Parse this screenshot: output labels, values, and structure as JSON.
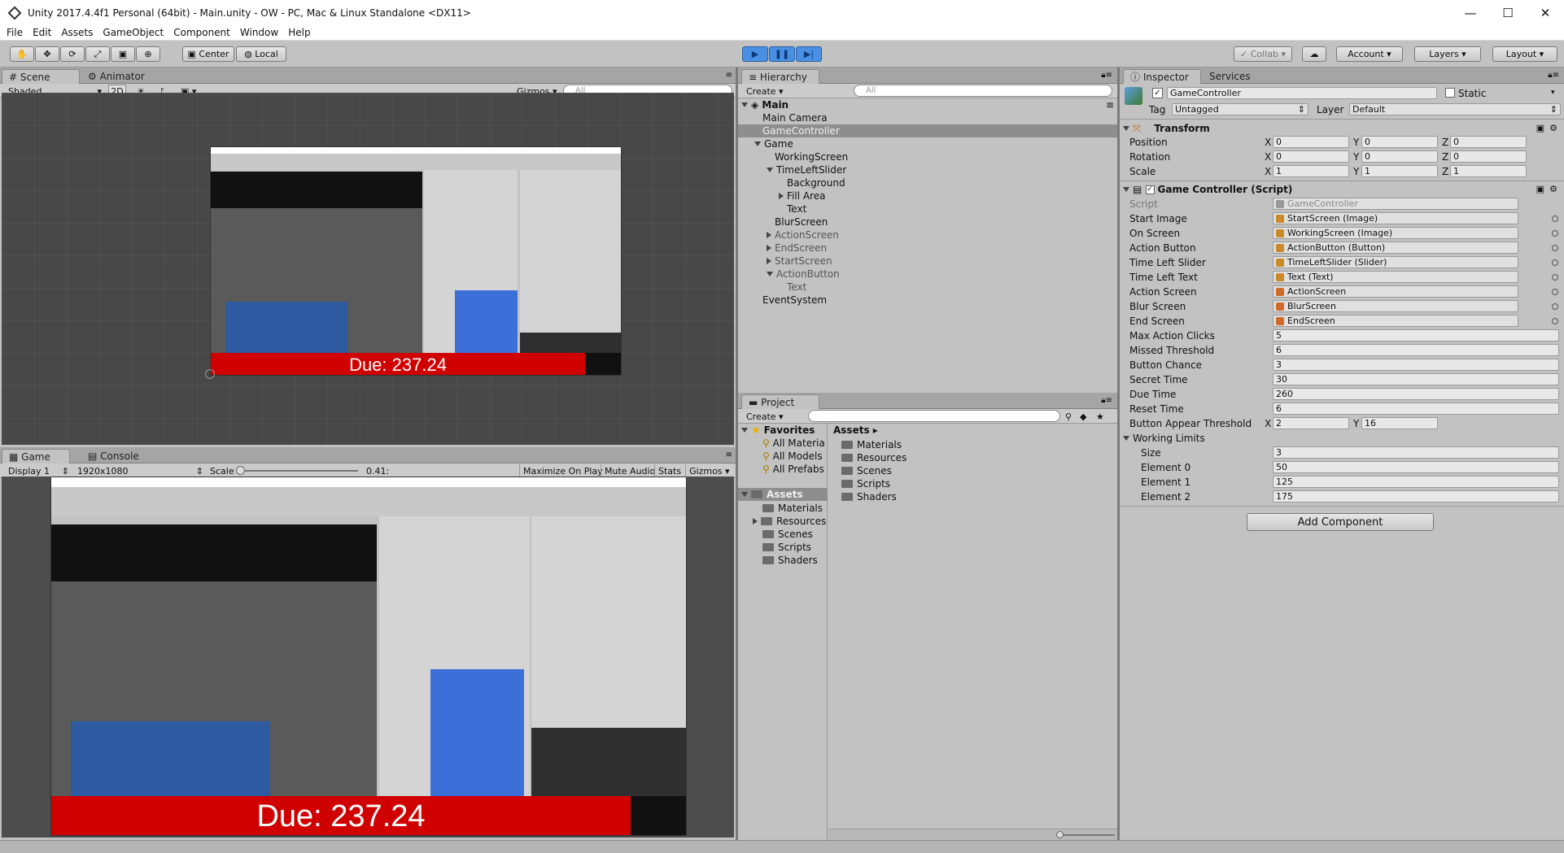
{
  "window": {
    "title": "Unity 2017.4.4f1 Personal (64bit) - Main.unity - OW - PC, Mac & Linux Standalone <DX11>",
    "minimize": "—",
    "maximize": "☐",
    "close": "✕"
  },
  "menu": [
    "File",
    "Edit",
    "Assets",
    "GameObject",
    "Component",
    "Window",
    "Help"
  ],
  "toolbar": {
    "pivot": "Center",
    "space": "Local",
    "collab": "Collab",
    "account": "Account",
    "layers": "Layers",
    "layout": "Layout"
  },
  "scene": {
    "tab_scene": "Scene",
    "tab_animator": "Animator",
    "shading": "Shaded",
    "mode_2d": "2D",
    "gizmos": "Gizmos",
    "search_placeholder": "All",
    "due_text": "Due: 237.24"
  },
  "game": {
    "tab_game": "Game",
    "tab_console": "Console",
    "display": "Display 1",
    "resolution": "1920x1080",
    "scale_label": "Scale",
    "scale_value": "0.41:",
    "maximize": "Maximize On Play",
    "mute": "Mute Audio",
    "stats": "Stats",
    "gizmos": "Gizmos",
    "due_text": "Due: 237.24"
  },
  "hierarchy": {
    "tab": "Hierarchy",
    "create": "Create",
    "search_placeholder": "All",
    "scene_name": "Main",
    "items": [
      {
        "label": "Main Camera"
      },
      {
        "label": "GameController"
      },
      {
        "label": "Game"
      },
      {
        "label": "WorkingScreen"
      },
      {
        "label": "TimeLeftSlider"
      },
      {
        "label": "Background"
      },
      {
        "label": "Fill Area"
      },
      {
        "label": "Text"
      },
      {
        "label": "BlurScreen"
      },
      {
        "label": "ActionScreen"
      },
      {
        "label": "EndScreen"
      },
      {
        "label": "StartScreen"
      },
      {
        "label": "ActionButton"
      },
      {
        "label": "Text"
      },
      {
        "label": "EventSystem"
      }
    ]
  },
  "project": {
    "tab": "Project",
    "create": "Create",
    "favorites": "Favorites",
    "fav_items": [
      "All Materia",
      "All Models",
      "All Prefabs"
    ],
    "assets": "Assets",
    "asset_folders": [
      "Materials",
      "Resources",
      "Scenes",
      "Scripts",
      "Shaders"
    ],
    "breadcrumb": "Assets",
    "right_folders": [
      "Materials",
      "Resources",
      "Scenes",
      "Scripts",
      "Shaders"
    ]
  },
  "inspector": {
    "tab": "Inspector",
    "tab_services": "Services",
    "object_name": "GameController",
    "static": "Static",
    "tag_label": "Tag",
    "tag_value": "Untagged",
    "layer_label": "Layer",
    "layer_value": "Default",
    "transform": "Transform",
    "position": "Position",
    "rotation": "Rotation",
    "scale": "Scale",
    "pos": [
      "0",
      "0",
      "0"
    ],
    "rot": [
      "0",
      "0",
      "0"
    ],
    "scl": [
      "1",
      "1",
      "1"
    ],
    "axis_x": "X",
    "axis_y": "Y",
    "axis_z": "Z",
    "script_component": "Game Controller (Script)",
    "script_label": "Script",
    "script_value": "GameController",
    "refs": [
      {
        "label": "Start Image",
        "value": "StartScreen (Image)"
      },
      {
        "label": "On Screen",
        "value": "WorkingScreen (Image)"
      },
      {
        "label": "Action Button",
        "value": "ActionButton (Button)"
      },
      {
        "label": "Time Left Slider",
        "value": "TimeLeftSlider (Slider)"
      },
      {
        "label": "Time Left Text",
        "value": "Text (Text)"
      },
      {
        "label": "Action Screen",
        "value": "ActionScreen"
      },
      {
        "label": "Blur Screen",
        "value": "BlurScreen"
      },
      {
        "label": "End Screen",
        "value": "EndScreen"
      }
    ],
    "values": [
      {
        "label": "Max Action Clicks",
        "value": "5"
      },
      {
        "label": "Missed Threshold",
        "value": "6"
      },
      {
        "label": "Button Chance",
        "value": "3"
      },
      {
        "label": "Secret Time",
        "value": "30"
      },
      {
        "label": "Due Time",
        "value": "260"
      },
      {
        "label": "Reset Time",
        "value": "6"
      }
    ],
    "appear_label": "Button Appear Threshold",
    "appear_x": "2",
    "appear_y": "16",
    "working_limits": "Working Limits",
    "size_label": "Size",
    "size_value": "3",
    "elements": [
      {
        "label": "Element 0",
        "value": "50"
      },
      {
        "label": "Element 1",
        "value": "125"
      },
      {
        "label": "Element 2",
        "value": "175"
      }
    ],
    "add_component": "Add Component"
  }
}
